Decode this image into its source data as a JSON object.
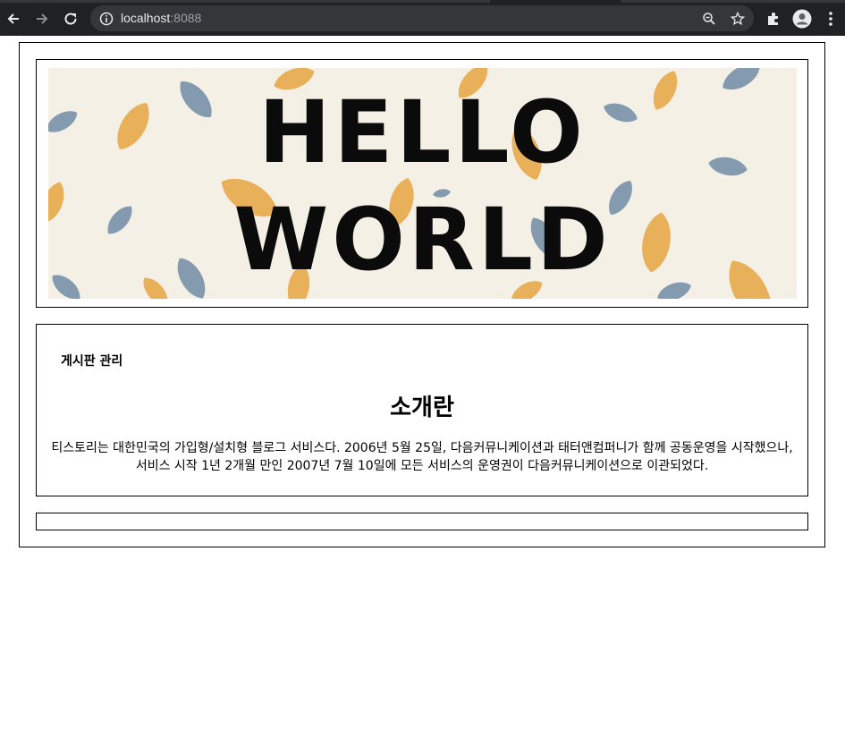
{
  "browser": {
    "url_host": "localhost",
    "url_port": ":8088"
  },
  "banner": {
    "line1": "HELLO",
    "line2": "WORLD",
    "colors": {
      "background": "#f4f0e6",
      "leaf_orange": "#e8a94a",
      "leaf_blue": "#6f8ba5",
      "text": "#0b0b0b"
    }
  },
  "content": {
    "board_link": "게시판 관리",
    "title": "소개란",
    "body_line1": "티스토리는 대한민국의 가입형/설치형 블로그 서비스다. 2006년 5월 25일, 다음커뮤니케이션과 태터앤컴퍼니가 함께 공동운영을 시작했으나,",
    "body_line2": "서비스 시작 1년 2개월 만인 2007년 7월 10일에 모든 서비스의 운영권이 다음커뮤니케이션으로 이관되었다."
  }
}
